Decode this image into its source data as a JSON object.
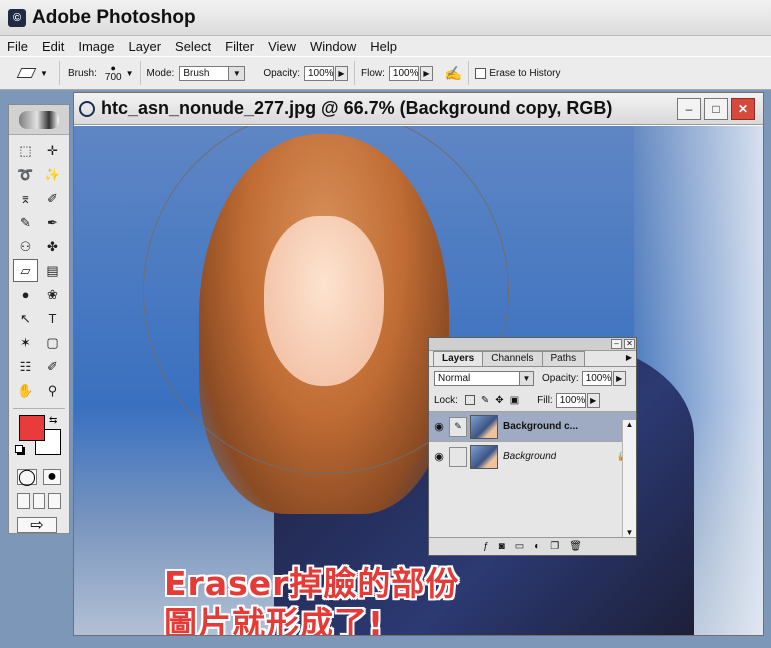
{
  "app": {
    "title": "Adobe Photoshop",
    "logo_glyph": "©"
  },
  "menu": [
    "File",
    "Edit",
    "Image",
    "Layer",
    "Select",
    "Filter",
    "View",
    "Window",
    "Help"
  ],
  "options_bar": {
    "brush_label": "Brush:",
    "brush_size": "700",
    "mode_label": "Mode:",
    "mode_value": "Brush",
    "opacity_label": "Opacity:",
    "opacity_value": "100%",
    "flow_label": "Flow:",
    "flow_value": "100%",
    "erase_history_label": "Erase to History"
  },
  "toolbox": {
    "tools": [
      "⬚",
      "✛",
      "➰",
      "✨",
      "⌆",
      "✐",
      "✎",
      "✒",
      "⚇",
      "✤",
      "▱",
      "▤",
      "●",
      "❀",
      "↖",
      "T",
      "✶",
      "▢",
      "☷",
      "✐",
      "✋",
      "⚲"
    ],
    "active_tool_index": 10
  },
  "document": {
    "title": "htc_asn_nonude_277.jpg @ 66.7% (Background copy, RGB)",
    "min_glyph": "–",
    "max_glyph": "□",
    "close_glyph": "✕"
  },
  "caption": {
    "line1": "Eraser掉臉的部份",
    "line2": "圖片就形成了!"
  },
  "layers_panel": {
    "tabs": [
      "Layers",
      "Channels",
      "Paths"
    ],
    "blend_mode": "Normal",
    "opacity_label": "Opacity:",
    "opacity_value": "100%",
    "lock_label": "Lock:",
    "fill_label": "Fill:",
    "fill_value": "100%",
    "layers": [
      {
        "name": "Background c...",
        "selected": true
      },
      {
        "name": "Background",
        "selected": false
      }
    ]
  },
  "colors": {
    "foreground": "#e83c3c",
    "background": "#ffffff",
    "caption": "#e63a37"
  }
}
